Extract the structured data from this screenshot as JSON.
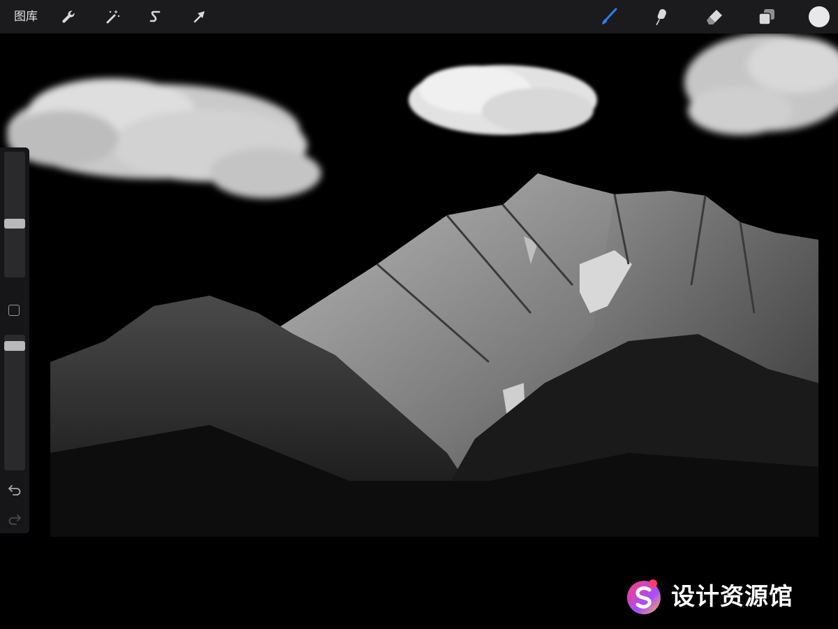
{
  "toolbar": {
    "gallery_label": "图库",
    "left_tools": [
      {
        "name": "actions",
        "icon": "wrench-icon"
      },
      {
        "name": "adjustments",
        "icon": "magic-wand-icon"
      },
      {
        "name": "selection",
        "icon": "selection-s-icon"
      },
      {
        "name": "transform",
        "icon": "arrow-cursor-icon"
      }
    ],
    "right_tools": [
      {
        "name": "brush",
        "icon": "brush-icon",
        "active": true
      },
      {
        "name": "smudge",
        "icon": "smudge-finger-icon",
        "active": false
      },
      {
        "name": "eraser",
        "icon": "eraser-icon",
        "active": false
      },
      {
        "name": "layers",
        "icon": "layers-icon",
        "active": false
      },
      {
        "name": "color",
        "icon": "color-circle",
        "active": false
      }
    ],
    "active_color": "#2d7ff9",
    "current_color": "#e8e8ea"
  },
  "sidebar": {
    "brush_size": 0.42,
    "brush_opacity": 0.95,
    "modifier_icon": "square-modifier-icon",
    "undo_icon": "undo-arrow-icon",
    "redo_icon": "redo-arrow-icon"
  },
  "watermark": {
    "text": "设计资源馆",
    "logo_colors": [
      "#ff3d6e",
      "#a64dff",
      "#ffb347"
    ]
  }
}
